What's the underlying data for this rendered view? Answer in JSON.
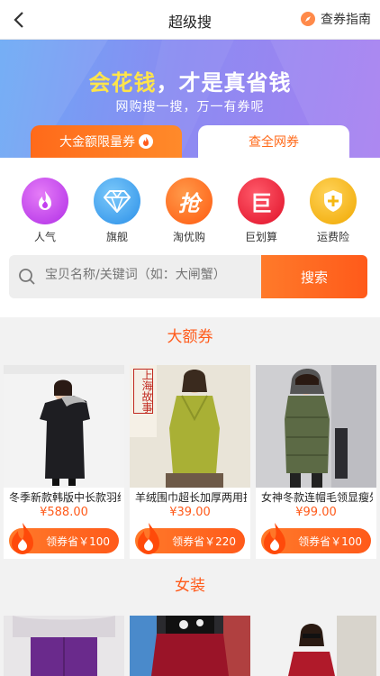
{
  "header": {
    "title": "超级搜",
    "guide_label": "查券指南",
    "icons": {
      "back": "chevron-left-icon",
      "guide": "compass-icon"
    }
  },
  "banner": {
    "headline_highlight": "会花钱",
    "headline_rest": "，才是真省钱",
    "subtitle": "网购搜一搜，万一有券呢",
    "tab_left": "大金额限量券",
    "tab_right": "查全网券"
  },
  "categories": [
    {
      "label": "人气",
      "icon": "flame-icon",
      "color": "#c23ef0"
    },
    {
      "label": "旗舰",
      "icon": "diamond-icon",
      "color": "#3aa6f0"
    },
    {
      "label": "淘优购",
      "icon": "grab-icon",
      "color": "#ff6a1a",
      "glyph": "抢"
    },
    {
      "label": "巨划算",
      "icon": "big-deal-icon",
      "color": "#f0233a",
      "glyph": "巨"
    },
    {
      "label": "运费险",
      "icon": "shield-icon",
      "color": "#f5b814"
    }
  ],
  "search": {
    "placeholder": "宝贝名称/关键词（如：大闸蟹）",
    "button": "搜索"
  },
  "sections": {
    "big_coupon": "大额券",
    "women": "女装"
  },
  "products": [
    {
      "name": "冬季新款韩版中长款羽绒服",
      "price": "¥588.00",
      "coupon": "领券省￥100"
    },
    {
      "name": "羊绒围巾超长加厚两用披肩",
      "price": "¥39.00",
      "coupon": "领券省￥220",
      "img_text": "上海故事"
    },
    {
      "name": "女神冬款连帽毛领显瘦外套",
      "price": "¥99.00",
      "coupon": "领券省￥100"
    }
  ],
  "colors": {
    "accent": "#ff5a1a",
    "banner_start": "#6aa9f5",
    "banner_end": "#a77ff0",
    "headline_highlight": "#ffe54a"
  }
}
